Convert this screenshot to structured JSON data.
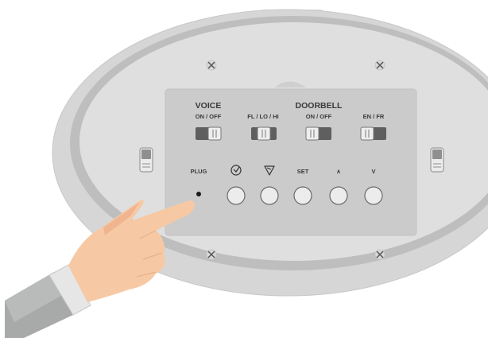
{
  "panel": {
    "voice": {
      "title": "VOICE",
      "switch_label": "ON / OFF"
    },
    "doorbell": {
      "title": "DOORBELL",
      "switch_labels": [
        "FL / LO / HI",
        "ON / OFF",
        "EN / FR"
      ]
    },
    "buttons": {
      "plug": "PLUG",
      "clock_icon": "clock-icon",
      "timer_icon": "timer-icon",
      "set": "SET",
      "up": "∧",
      "down": "V"
    }
  },
  "colors": {
    "housing": "#d2d2d2",
    "rim": "#dedede",
    "panel": "#cdcdcd",
    "skin": "#f5c7a2",
    "sleeve": "#a7aaa9"
  }
}
